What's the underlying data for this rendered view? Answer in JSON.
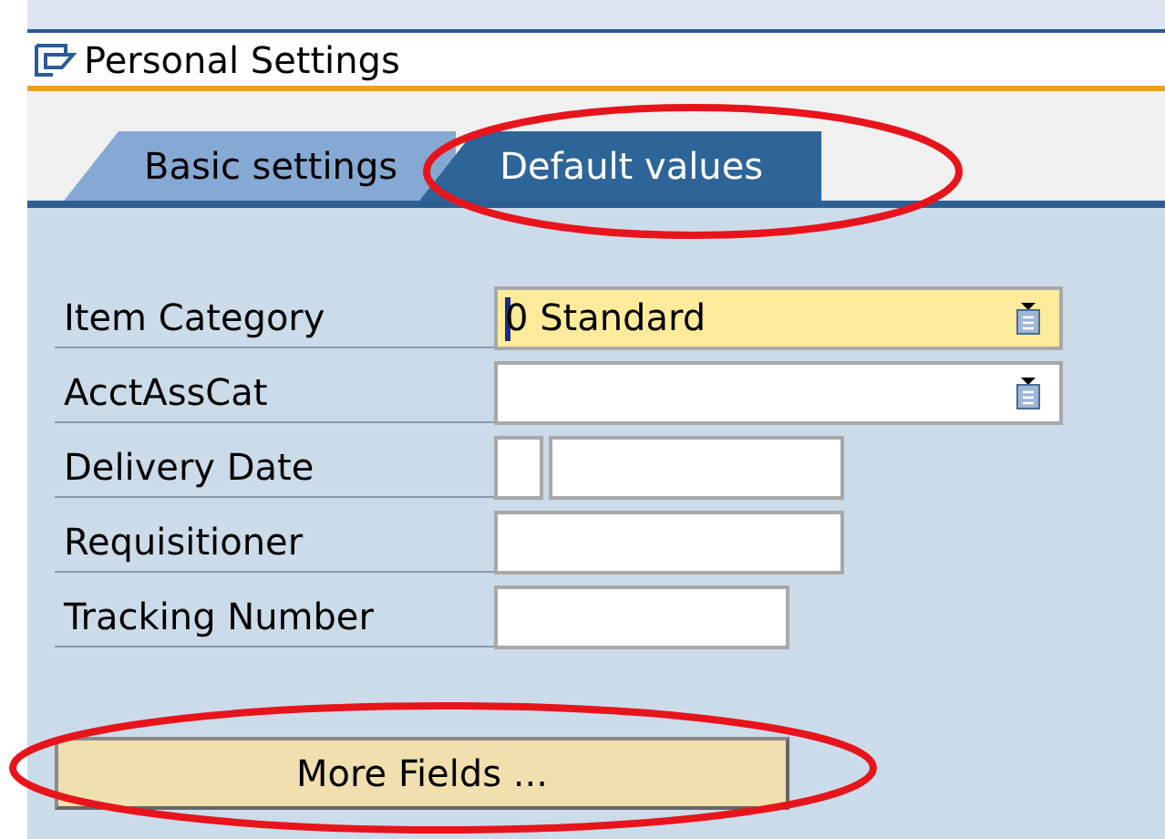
{
  "window": {
    "title": "Personal Settings"
  },
  "tabs": [
    {
      "label": "Basic settings",
      "selected": false
    },
    {
      "label": "Default values",
      "selected": true
    }
  ],
  "fields": [
    {
      "label": "Item Category",
      "kind": "dropdown",
      "value": "0 Standard",
      "focused": true
    },
    {
      "label": "AcctAssCat",
      "kind": "dropdown",
      "focused": false
    },
    {
      "label": "Delivery Date",
      "kind": "pair",
      "focused": false
    },
    {
      "label": "Requisitioner",
      "kind": "text",
      "focused": false
    },
    {
      "label": "Tracking Number",
      "kind": "short-text",
      "focused": false
    }
  ],
  "button": {
    "label": "More Fields ..."
  }
}
